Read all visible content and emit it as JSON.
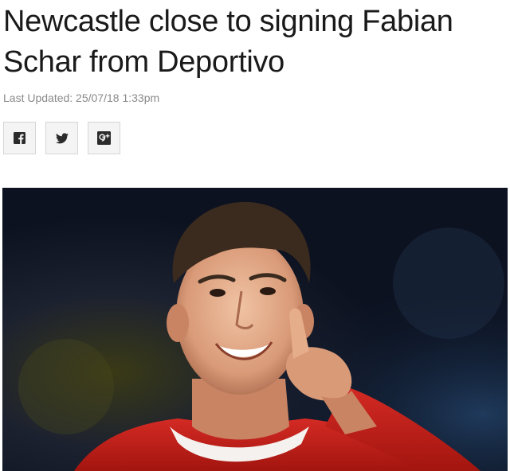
{
  "article": {
    "headline": "Newcastle close to signing Fabian Schar from Deportivo",
    "last_updated": "Last Updated: 25/07/18 1:33pm"
  },
  "share": {
    "buttons": [
      {
        "icon": "facebook-icon"
      },
      {
        "icon": "twitter-icon"
      },
      {
        "icon": "google-plus-icon"
      }
    ]
  },
  "image": {
    "subject": "footballer-pointing-photo",
    "colors": {
      "shirt": "#d42a24",
      "background": "#101a2c"
    }
  }
}
